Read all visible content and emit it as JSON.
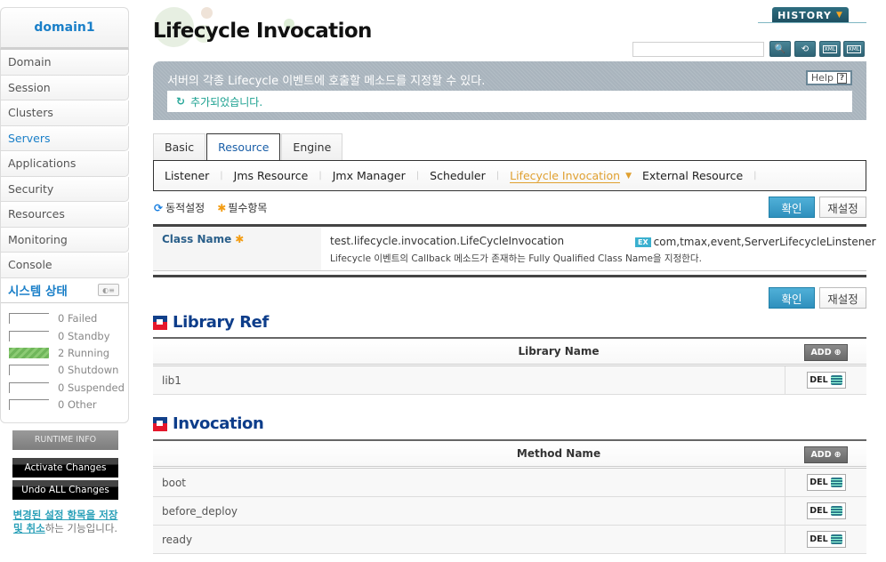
{
  "sidebar": {
    "domain": "domain1",
    "items": [
      {
        "label": "Domain"
      },
      {
        "label": "Session"
      },
      {
        "label": "Clusters"
      },
      {
        "label": "Servers",
        "active": true
      },
      {
        "label": "Applications"
      },
      {
        "label": "Security"
      },
      {
        "label": "Resources"
      },
      {
        "label": "Monitoring"
      },
      {
        "label": "Console"
      }
    ],
    "system_status": {
      "title": "시스템 상태",
      "rows": [
        {
          "count": "0",
          "label": "Failed",
          "fill": 0
        },
        {
          "count": "0",
          "label": "Standby",
          "fill": 0
        },
        {
          "count": "2",
          "label": "Running",
          "fill": 1
        },
        {
          "count": "0",
          "label": "Shutdown",
          "fill": 0
        },
        {
          "count": "0",
          "label": "Suspended",
          "fill": 0
        },
        {
          "count": "0",
          "label": "Other",
          "fill": 0
        }
      ]
    },
    "runtime_info_label": "RUNTIME INFO",
    "activate_label": "Activate Changes",
    "undo_label": "Undo ALL Changes",
    "note_link": "변경된 설정 항목을 저장 및 취소",
    "note_rest": "하는 기능입니다."
  },
  "header": {
    "title": "Lifecycle Invocation",
    "history_label": "HISTORY",
    "search_value": "",
    "icons": [
      "search-icon",
      "refresh-icon",
      "xml-export-icon",
      "xml-import-icon"
    ]
  },
  "banner": {
    "description": "서버의 각종 Lifecycle 이벤트에 호출할 메소드를 지정할 수 있다.",
    "help_label": "Help",
    "message": "추가되었습니다."
  },
  "tabs": [
    {
      "label": "Basic"
    },
    {
      "label": "Resource",
      "active": true
    },
    {
      "label": "Engine"
    }
  ],
  "subtabs": [
    {
      "label": "Listener"
    },
    {
      "label": "Jms Resource"
    },
    {
      "label": "Jmx Manager"
    },
    {
      "label": "Scheduler"
    },
    {
      "label": "Lifecycle Invocation",
      "active": true
    },
    {
      "label": "External Resource"
    }
  ],
  "legend": {
    "dynamic": "동적설정",
    "required": "필수항목"
  },
  "buttons": {
    "confirm": "확인",
    "reset": "재설정",
    "add": "ADD",
    "del": "DEL"
  },
  "form": {
    "class_name_label": "Class Name",
    "class_name_value": "test.lifecycle.invocation.LifeCycleInvocation",
    "class_name_desc": "Lifecycle 이벤트의 Callback 메소드가 존재하는 Fully Qualified Class Name을 지정한다.",
    "example_badge": "EX",
    "example_value": "com,tmax,event,ServerLifecycleLinstener"
  },
  "library_ref": {
    "title": "Library Ref",
    "column": "Library Name",
    "rows": [
      "lib1"
    ]
  },
  "invocation": {
    "title": "Invocation",
    "column": "Method Name",
    "rows": [
      "boot",
      "before_deploy",
      "ready"
    ]
  }
}
